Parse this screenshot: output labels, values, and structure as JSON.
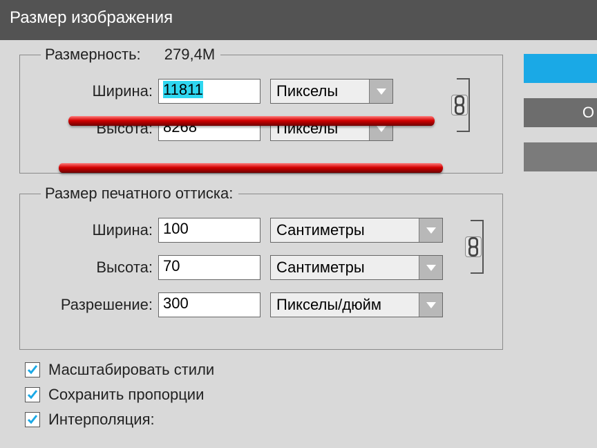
{
  "window": {
    "title": "Размер изображения"
  },
  "dimensions": {
    "legend": "Размерность:",
    "size_display": "279,4M",
    "width_label": "Ширина:",
    "width_value": "11811",
    "width_unit": "Пикселы",
    "height_label": "Высота:",
    "height_value": "8268",
    "height_unit": "Пикселы"
  },
  "print": {
    "legend": "Размер печатного оттиска:",
    "width_label": "Ширина:",
    "width_value": "100",
    "width_unit": "Сантиметры",
    "height_label": "Высота:",
    "height_value": "70",
    "height_unit": "Сантиметры",
    "res_label": "Разрешение:",
    "res_value": "300",
    "res_unit": "Пикселы/дюйм"
  },
  "options": {
    "scale_styles": "Масштабировать стили",
    "keep_ratio": "Сохранить пропорции",
    "interpolation": "Интерполяция:"
  },
  "buttons": {
    "ok_fragment": "",
    "cancel_fragment": "О",
    "third_fragment": ""
  },
  "checked": {
    "scale_styles": true,
    "keep_ratio": true,
    "interpolation": true
  }
}
